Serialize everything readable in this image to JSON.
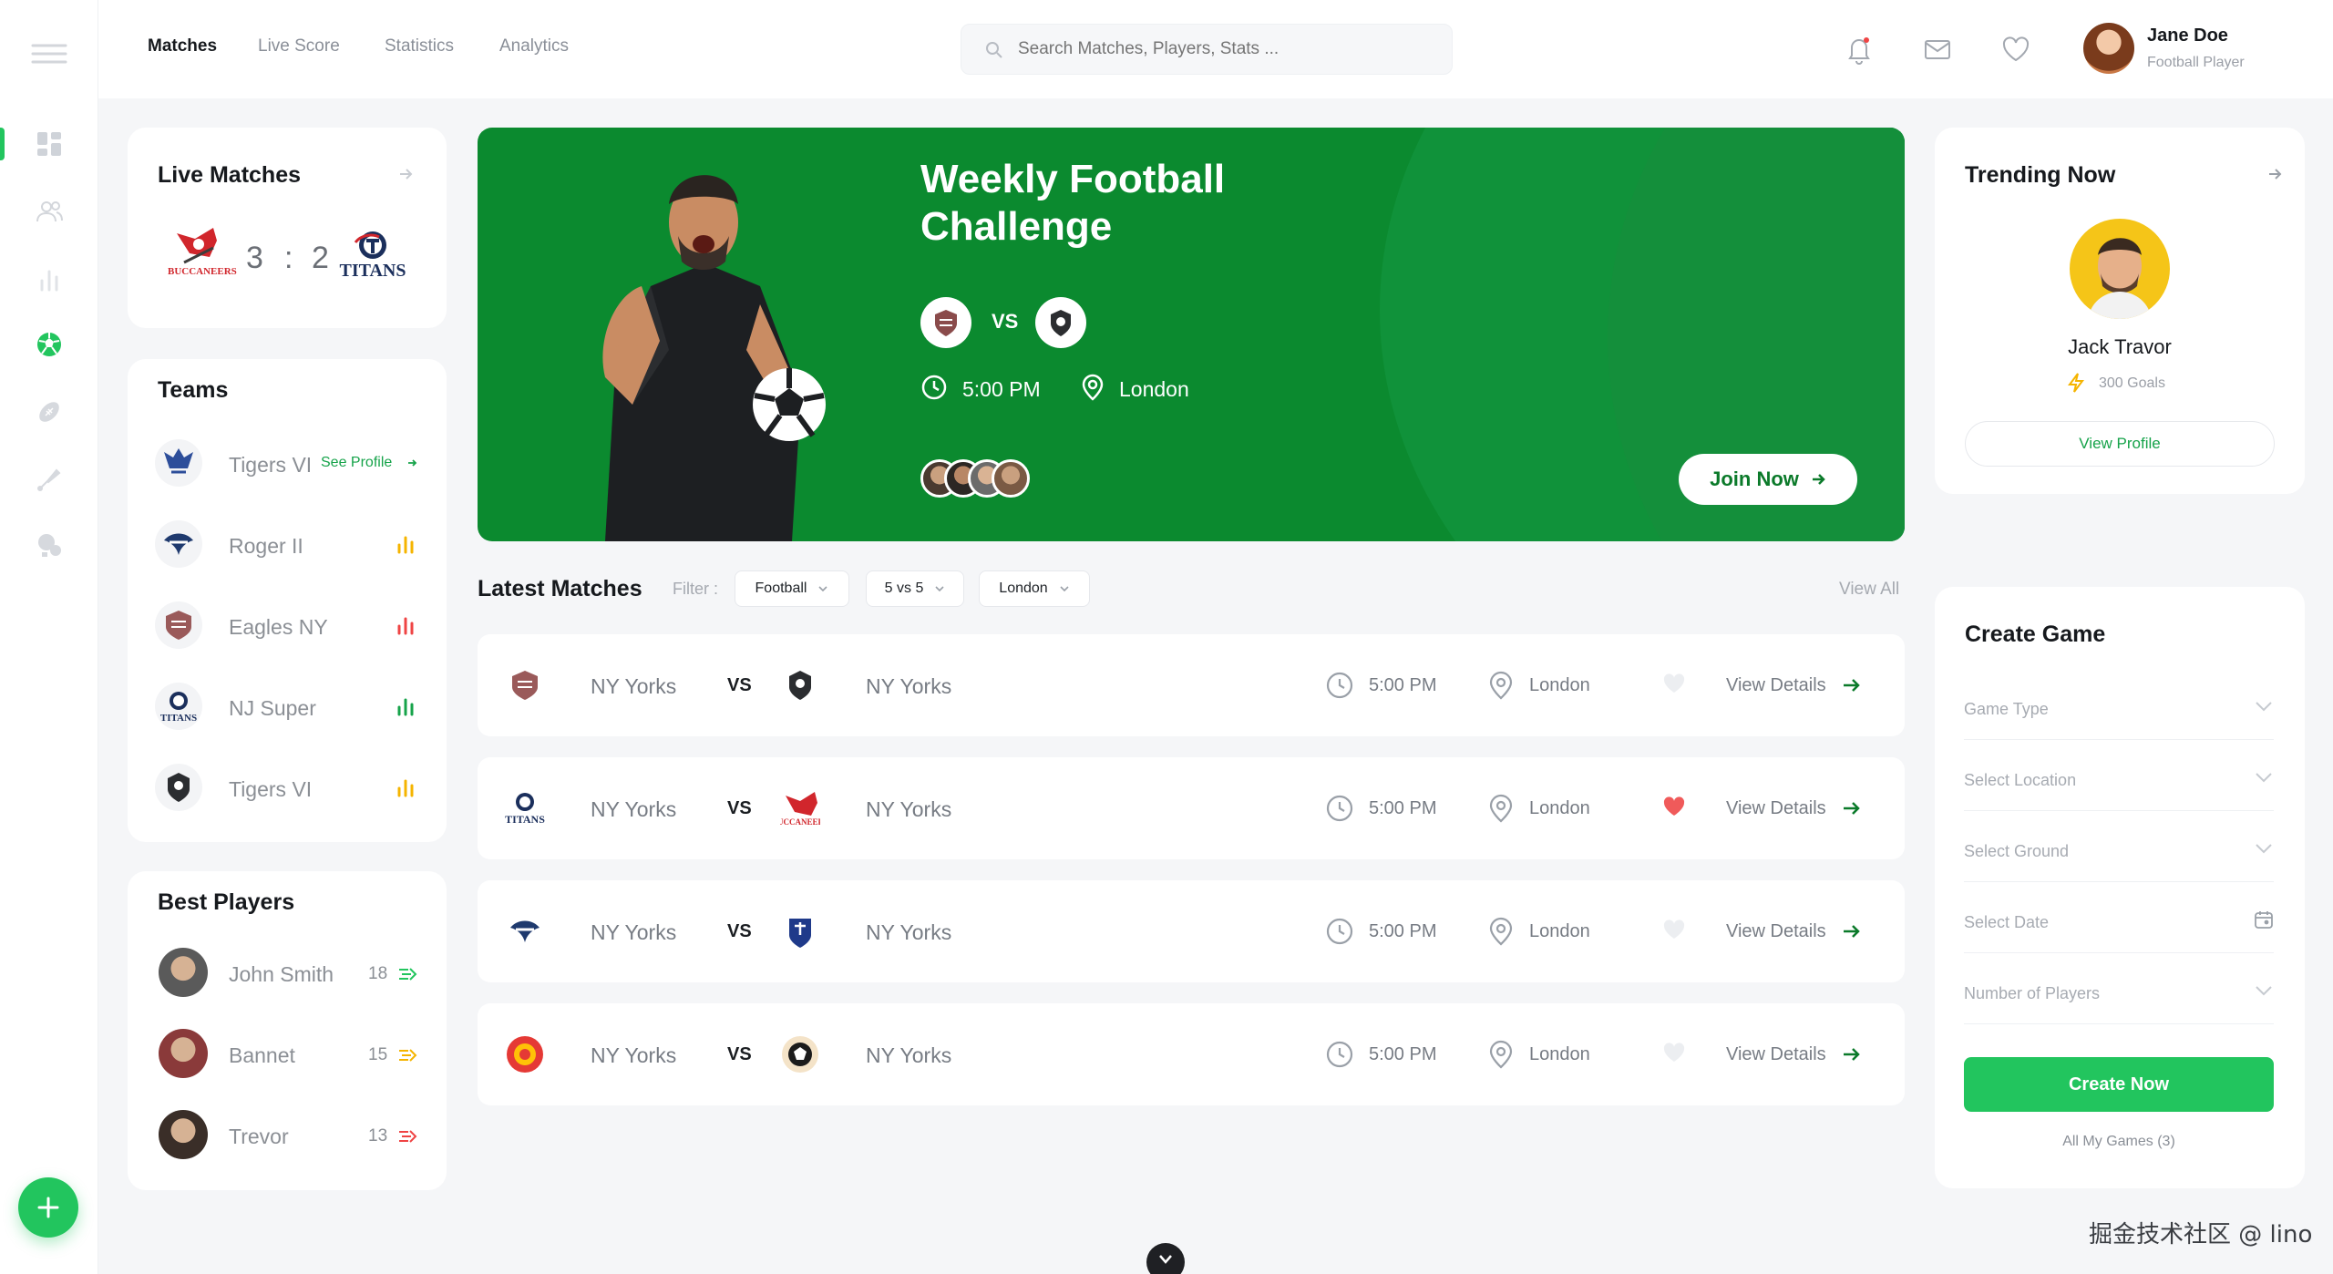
{
  "nav": {
    "tabs": [
      "Matches",
      "Live Score",
      "Statistics",
      "Analytics"
    ],
    "active": "Matches"
  },
  "search": {
    "placeholder": "Search Matches, Players, Stats ..."
  },
  "user": {
    "name": "Jane Doe",
    "role": "Football Player"
  },
  "colors": {
    "brand_green": "#0b8a2f",
    "accent_green": "#22c55e",
    "heart_red": "#f05a5a",
    "bg": "#f5f6f8"
  },
  "live": {
    "title": "Live Matches",
    "home_logo_text": "BUCCANEERS",
    "away_logo_text": "TITANS",
    "home_score": "3",
    "separator": ":",
    "away_score": "2"
  },
  "teams": {
    "title": "Teams",
    "see_profile": "See Profile",
    "items": [
      {
        "name": "Tigers VI",
        "icon": "chart-bar-icon",
        "color": "#22c55e"
      },
      {
        "name": "Roger II",
        "icon": "chart-bar-icon",
        "color": "#f5b400"
      },
      {
        "name": "Eagles NY",
        "icon": "chart-bar-icon",
        "color": "#ef4444"
      },
      {
        "name": "NJ Super",
        "icon": "chart-bar-icon",
        "color": "#16a34a"
      },
      {
        "name": "Tigers VI",
        "icon": "chart-bar-icon",
        "color": "#f5b400"
      }
    ]
  },
  "best_players": {
    "title": "Best Players",
    "items": [
      {
        "name": "John Smith",
        "score": "18",
        "trend_color": "#22c55e"
      },
      {
        "name": "Bannet",
        "score": "15",
        "trend_color": "#f5b400"
      },
      {
        "name": "Trevor",
        "score": "13",
        "trend_color": "#ef4444"
      }
    ]
  },
  "hero": {
    "title_line1": "Weekly Football",
    "title_line2": "Challenge",
    "vs": "VS",
    "time": "5:00 PM",
    "location": "London",
    "join": "Join Now"
  },
  "latest": {
    "title": "Latest Matches",
    "filter_label": "Filter :",
    "filters": [
      "Football",
      "5 vs 5",
      "London"
    ],
    "view_all": "View All",
    "matches": [
      {
        "home": "NY Yorks",
        "vs": "VS",
        "away": "NY Yorks",
        "time": "5:00 PM",
        "location": "London",
        "favorite": false,
        "details": "View Details"
      },
      {
        "home": "NY Yorks",
        "vs": "VS",
        "away": "NY Yorks",
        "time": "5:00 PM",
        "location": "London",
        "favorite": true,
        "details": "View Details"
      },
      {
        "home": "NY Yorks",
        "vs": "VS",
        "away": "NY Yorks",
        "time": "5:00 PM",
        "location": "London",
        "favorite": false,
        "details": "View Details"
      },
      {
        "home": "NY Yorks",
        "vs": "VS",
        "away": "NY Yorks",
        "time": "5:00 PM",
        "location": "London",
        "favorite": false,
        "details": "View Details"
      }
    ]
  },
  "trending": {
    "title": "Trending Now",
    "name": "Jack Travor",
    "goals": "300 Goals",
    "view_profile": "View Profile"
  },
  "create_game": {
    "title": "Create Game",
    "fields": [
      "Game Type",
      "Select Location",
      "Select Ground",
      "Select Date",
      "Number of Players"
    ],
    "button": "Create Now",
    "all_games": "All My Games (3)"
  },
  "watermark": "掘金技术社区 @ lino"
}
